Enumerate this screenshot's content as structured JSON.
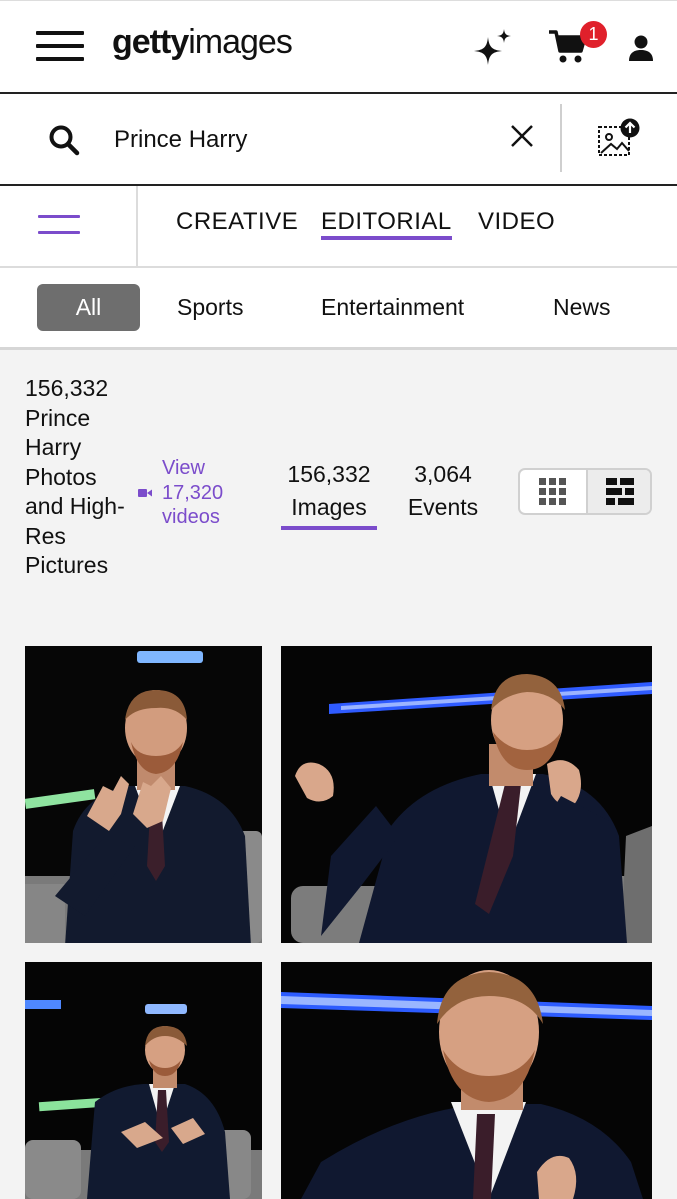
{
  "header": {
    "logo_bold": "getty",
    "logo_light": "images",
    "cart_count": "1",
    "icons": [
      "menu-icon",
      "sparkle-icon",
      "cart-icon",
      "user-icon"
    ]
  },
  "search": {
    "value": "Prince Harry",
    "icons": [
      "search-icon",
      "clear-icon",
      "image-search-icon"
    ]
  },
  "tabs": [
    {
      "label": "CREATIVE",
      "active": false
    },
    {
      "label": "EDITORIAL",
      "active": true
    },
    {
      "label": "VIDEO",
      "active": false
    }
  ],
  "chips": [
    {
      "label": "All",
      "active": true
    },
    {
      "label": "Sports",
      "active": false
    },
    {
      "label": "Entertainment",
      "active": false
    },
    {
      "label": "News",
      "active": false
    }
  ],
  "results": {
    "title": "156,332 Prince Harry Photos and High-Res Pictures",
    "video_link": "View 17,320 videos",
    "images_count": "156,332",
    "images_label": "Images",
    "events_count": "3,064",
    "events_label": "Events",
    "view_mode": "mosaic"
  },
  "colors": {
    "accent": "#7b4ccb",
    "badge": "#e0202b",
    "chip_active": "#6e6e6e"
  },
  "photos": [
    {
      "subject": "Prince Harry gesturing with both hands, seated on stage"
    },
    {
      "subject": "Prince Harry speaking, seated, blue light behind"
    },
    {
      "subject": "Prince Harry seated in grey armchair, wide shot"
    },
    {
      "subject": "Prince Harry close-up, smiling, blue light behind"
    }
  ]
}
